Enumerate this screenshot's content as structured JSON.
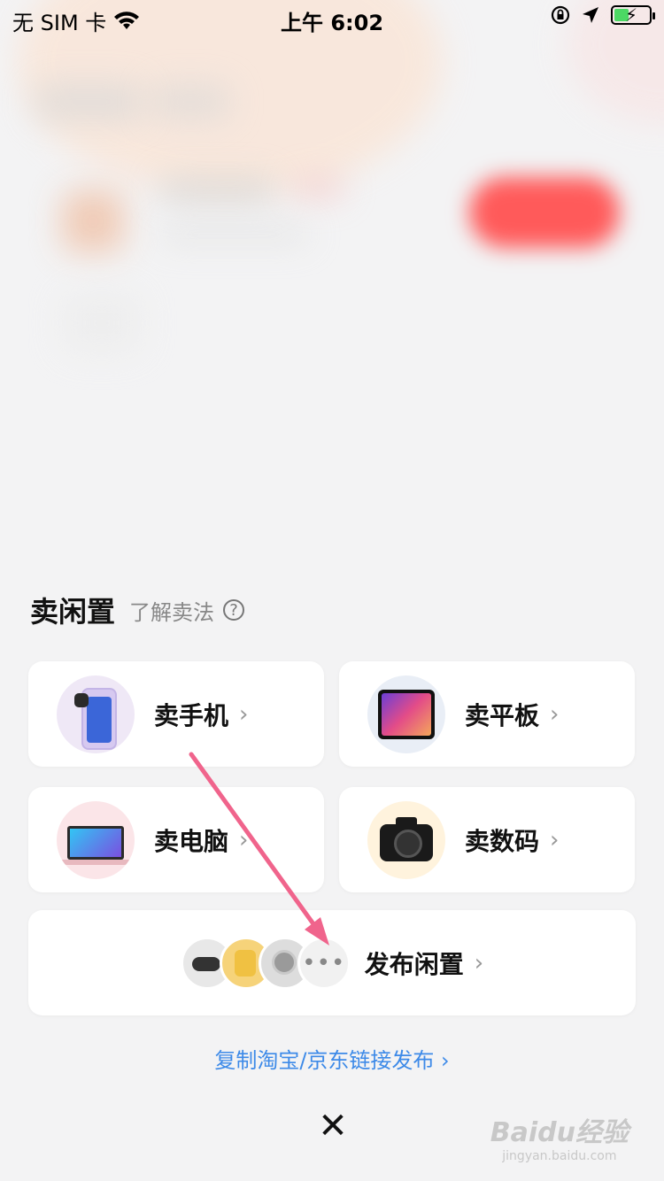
{
  "status_bar": {
    "carrier": "无 SIM 卡",
    "time": "上午 6:02",
    "battery_color": "#4cd964"
  },
  "sheet": {
    "title": "卖闲置",
    "subtitle": "了解卖法",
    "help_symbol": "?"
  },
  "categories": [
    {
      "label": "卖手机",
      "icon": "phone-icon"
    },
    {
      "label": "卖平板",
      "icon": "tablet-icon"
    },
    {
      "label": "卖电脑",
      "icon": "laptop-icon"
    },
    {
      "label": "卖数码",
      "icon": "camera-icon"
    }
  ],
  "publish": {
    "label": "发布闲置",
    "more_symbol": "•••"
  },
  "link": {
    "label": "复制淘宝/京东链接发布 ›",
    "color": "#3d8ae8"
  },
  "close_symbol": "✕",
  "chevron": "›",
  "watermark": {
    "logo": "Baidu经验",
    "url": "jingyan.baidu.com"
  },
  "annotation_color": "#f0648c"
}
